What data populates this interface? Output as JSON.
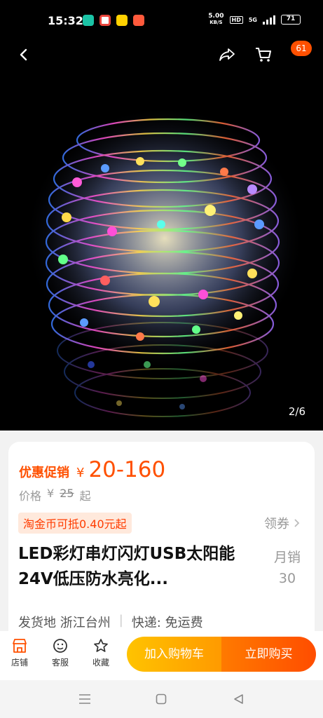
{
  "status_bar": {
    "time": "15:32",
    "speed_value": "5.00",
    "speed_unit": "KB/S",
    "hd": "HD",
    "network": "5G",
    "battery": "71"
  },
  "hero": {
    "image_counter": "2/6",
    "cart_badge": "61"
  },
  "product": {
    "promo_label": "优惠促销",
    "currency": "¥",
    "promo_price": "20-160",
    "orig_label": "价格",
    "orig_price": "25",
    "orig_suffix": "起",
    "coin_tag": "淘金币可抵0.40元起",
    "coupon_label": "领券",
    "title": "LED彩灯串灯闪灯USB太阳能24V低压防水亮化...",
    "monthly_label": "月销",
    "monthly_value": "30",
    "ship_from": "发货地 浙江台州",
    "delivery": "快递: 免运费"
  },
  "action_bar": {
    "shop": "店铺",
    "service": "客服",
    "favorite": "收藏",
    "add_to_cart": "加入购物车",
    "buy_now": "立即购买"
  }
}
